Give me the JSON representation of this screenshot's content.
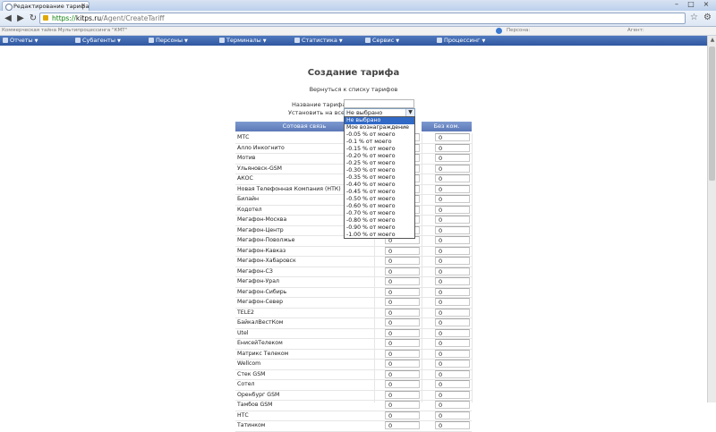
{
  "browser": {
    "tab_title": "Редактирование тарифа",
    "url_scheme": "https://",
    "url_host": "kitps.ru",
    "url_path": "/Agent/CreateTariff"
  },
  "infobar": {
    "left": "Коммерческая тайна Мультипроцессинга \"КМТ\"",
    "persons": "Персона:",
    "agent": "Агент:"
  },
  "menu": [
    {
      "label": "Отчеты"
    },
    {
      "label": "Субагенты"
    },
    {
      "label": "Персоны"
    },
    {
      "label": "Терминалы"
    },
    {
      "label": "Статистика"
    },
    {
      "label": "Сервис"
    },
    {
      "label": "Процессинг"
    }
  ],
  "page": {
    "title": "Создание тарифа",
    "back_link": "Вернуться к списку тарифов",
    "name_label": "Название тарифа:",
    "apply_all_label": "Установить на всех:",
    "selected_value": "Не выбрано"
  },
  "table": {
    "headers": [
      "Сотовая связь",
      "",
      "Без ком."
    ],
    "default_value": "0",
    "rows": [
      "МТС",
      "Алло Инкогнито",
      "Мотив",
      "Ульяновск-GSM",
      "АКОС",
      "Новая Телефонная Компания (НТК)",
      "Билайн",
      "Кодотел",
      "Мегафон-Москва",
      "Мегафон-Центр",
      "Мегафон-Поволжье",
      "Мегафон-Кавказ",
      "Мегафон-Хабаровск",
      "Мегафон-СЗ",
      "Мегафон-Урал",
      "Мегафон-Сибирь",
      "Мегафон-Север",
      "TELE2",
      "БайкалВестКом",
      "Utel",
      "ЕнисейТелеком",
      "Матрикс Телеком",
      "Wellcom",
      "Стек GSM",
      "Сотел",
      "Оренбург GSM",
      "Тамбов GSM",
      "НТС",
      "Татинком"
    ]
  },
  "dropdown": {
    "options": [
      "Не выбрано",
      "Мое вознаграждение",
      "-0.05 % от моего",
      "-0.1 % от моего",
      "-0.15 % от моего",
      "-0.20 % от моего",
      "-0.25 % от моего",
      "-0.30 % от моего",
      "-0.35 % от моего",
      "-0.40 % от моего",
      "-0.45 % от моего",
      "-0.50 % от моего",
      "-0.60 % от моего",
      "-0.70 % от моего",
      "-0.80 % от моего",
      "-0.90 % от моего",
      "-1.00 % от моего"
    ]
  },
  "colors": {
    "menubar": "#3a62aa",
    "table_header": "#6a86c2",
    "selected_option": "#3169c6"
  }
}
